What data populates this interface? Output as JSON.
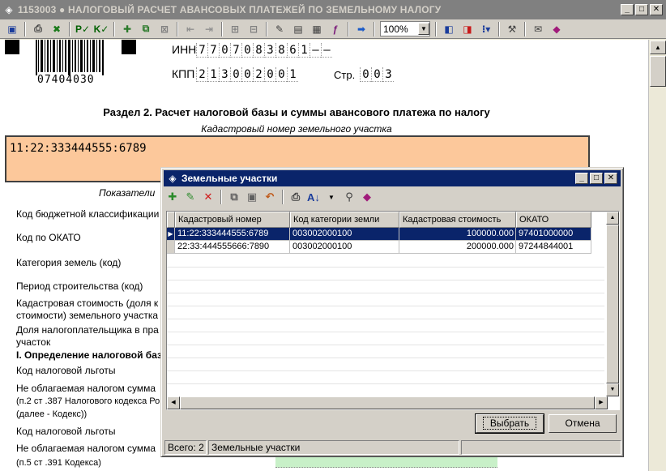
{
  "window": {
    "title": "1153003 ● НАЛОГОВЫЙ РАСЧЕТ АВАНСОВЫХ ПЛАТЕЖЕЙ ПО ЗЕМЕЛЬНОМУ НАЛОГУ",
    "minimize": "_",
    "maximize": "□",
    "close": "✕"
  },
  "toolbar": {
    "zoom": "100%"
  },
  "doc": {
    "barcode_number": "07404030",
    "inn_label": "ИНН",
    "inn_digits": [
      "7",
      "7",
      "0",
      "7",
      "0",
      "8",
      "3",
      "8",
      "6",
      "1",
      "–",
      "–"
    ],
    "kpp_label": "КПП",
    "kpp_digits": [
      "2",
      "1",
      "3",
      "0",
      "0",
      "2",
      "0",
      "0",
      "1"
    ],
    "page_label": "Стр.",
    "page_digits": [
      "0",
      "0",
      "3"
    ],
    "section_title": "Раздел 2. Расчет налоговой базы и суммы авансового платежа по налогу",
    "cadastral_label": "Кадастровый номер земельного участка",
    "cadastral_value": "11:22:333444555:6789",
    "indicators_label": "Показатели",
    "rows": [
      "Код бюджетной классификации",
      "Код по ОКАТО",
      "Категория земель (код)",
      "Период строительства (код)",
      "Кадастровая стоимость (доля к",
      "стоимости) земельного участка",
      "Доля налогоплательщика в пра",
      "участок",
      "I. Определение налоговой баз",
      "Код налоговой льготы",
      "Не облагаемая налогом сумма",
      "(п.2 ст .387 Налогового кодекса Ро",
      "(далее - Кодекс))",
      "Код налоговой льготы",
      "Не облагаемая налогом сумма",
      "(п.5 ст .391 Кодекса)"
    ]
  },
  "dialog": {
    "title": "Земельные участки",
    "columns": [
      "Кадастровый номер",
      "Код категории земли",
      "Кадастровая стоимость",
      "ОКАТО"
    ],
    "rows": [
      [
        "11:22:333444555:6789",
        "003002000100",
        "100000.000",
        "97401000000"
      ],
      [
        "22:33:444555666:7890",
        "003002000100",
        "200000.000",
        "97244844001"
      ]
    ],
    "select_button": "Выбрать",
    "cancel_button": "Отмена",
    "status_count": "Всего: 2",
    "status_name": "Земельные участки"
  }
}
